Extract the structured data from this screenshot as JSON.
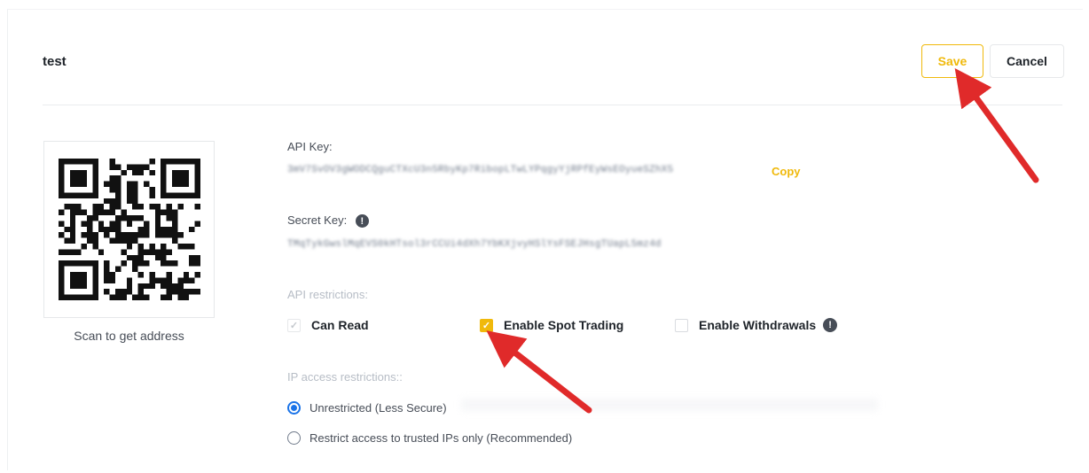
{
  "header": {
    "title": "test",
    "save_label": "Save",
    "cancel_label": "Cancel"
  },
  "qr": {
    "caption": "Scan to get address"
  },
  "api_key": {
    "label": "API Key:",
    "value": "3mV7SvOV3gWODCQguCTXcU3n5RbyKp7RibopLTwLYPqgyYjRPfEyWsEOyueSZhX5",
    "copy_label": "Copy"
  },
  "secret_key": {
    "label": "Secret Key:",
    "info_icon": "info-circle-icon",
    "value": "TMqTykGwslMqEVS0kHTsol3rCCUi4dXh7YbKXjvyHSlYsFSEJHsgTUapL5mz4d"
  },
  "api_restrictions": {
    "label": "API restrictions:",
    "options": [
      {
        "label": "Can Read",
        "state": "checked-disabled"
      },
      {
        "label": "Enable Spot Trading",
        "state": "checked"
      },
      {
        "label": "Enable Withdrawals",
        "state": "unchecked",
        "has_info": true
      }
    ]
  },
  "ip_restrictions": {
    "label": "IP access restrictions::",
    "options": [
      {
        "label": "Unrestricted (Less Secure)",
        "selected": true
      },
      {
        "label": "Restrict access to trusted IPs only (Recommended)",
        "selected": false
      }
    ]
  },
  "colors": {
    "accent": "#f0b90b",
    "radio": "#1a73e8",
    "annotation_arrow": "#e02a2a"
  }
}
